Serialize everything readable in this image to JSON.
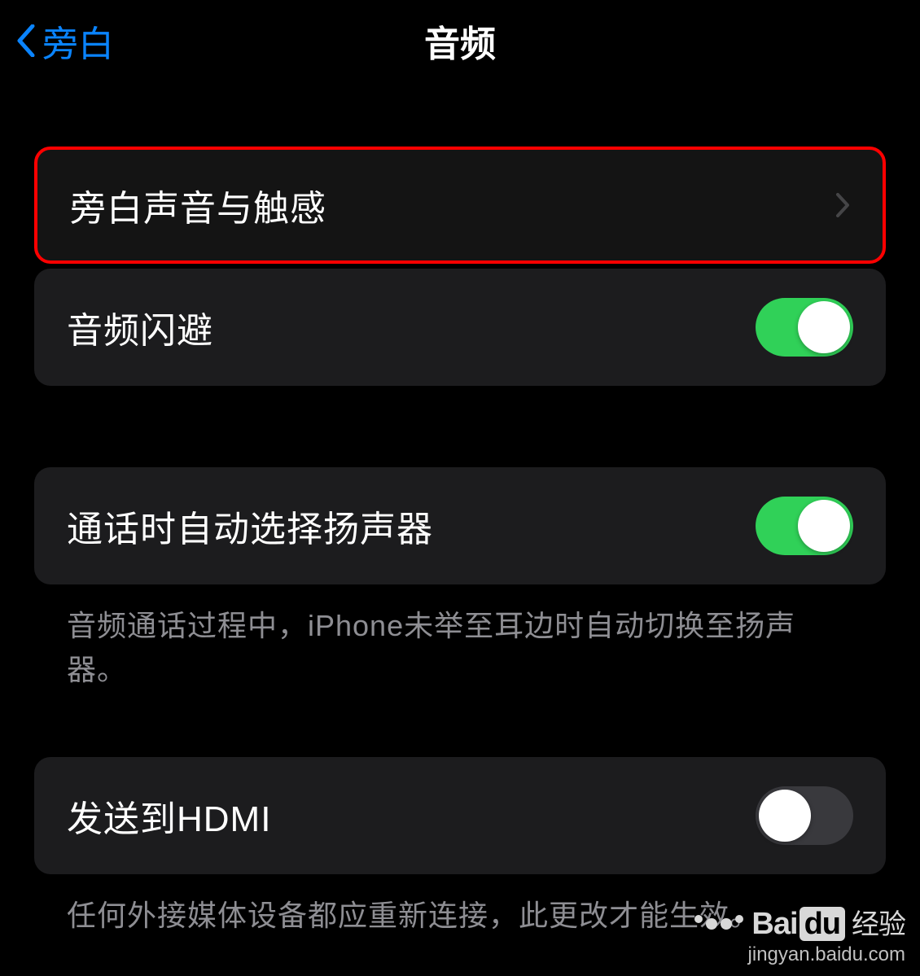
{
  "header": {
    "back_label": "旁白",
    "title": "音频"
  },
  "section1": {
    "items": [
      {
        "label": "旁白声音与触感",
        "type": "disclosure",
        "highlighted": true
      },
      {
        "label": "音频闪避",
        "type": "toggle",
        "on": true
      }
    ]
  },
  "section2": {
    "items": [
      {
        "label": "通话时自动选择扬声器",
        "type": "toggle",
        "on": true
      }
    ],
    "footer": "音频通话过程中，iPhone未举至耳边时自动切换至扬声器。"
  },
  "section3": {
    "items": [
      {
        "label": "发送到HDMI",
        "type": "toggle",
        "on": false
      }
    ],
    "footer": "任何外接媒体设备都应重新连接，此更改才能生效。"
  },
  "watermark": {
    "brand_prefix": "Bai",
    "brand_box": "du",
    "brand_suffix": "经验",
    "url": "jingyan.baidu.com"
  }
}
